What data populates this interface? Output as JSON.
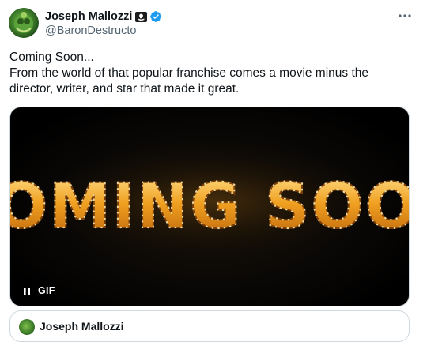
{
  "tweet": {
    "author": {
      "display_name": "Joseph Mallozzi",
      "handle": "@BaronDestructo",
      "avatar_icon": "avatar-image",
      "badges": [
        "pirate-flag-icon",
        "verified-badge-icon"
      ],
      "verified_color": "#1d9bf0"
    },
    "menu_icon": "more-options-icon",
    "text_lines": [
      "Coming Soon...",
      "From the world of that popular franchise comes a movie minus the",
      "director, writer, and star that made it great."
    ],
    "media": {
      "marquee_text": "COMING SOON",
      "gif_label": "GIF",
      "pause_icon": "pause-icon",
      "marquee_color": "#f0a020"
    },
    "quoted": {
      "display_name": "Joseph Mallozzi"
    }
  }
}
